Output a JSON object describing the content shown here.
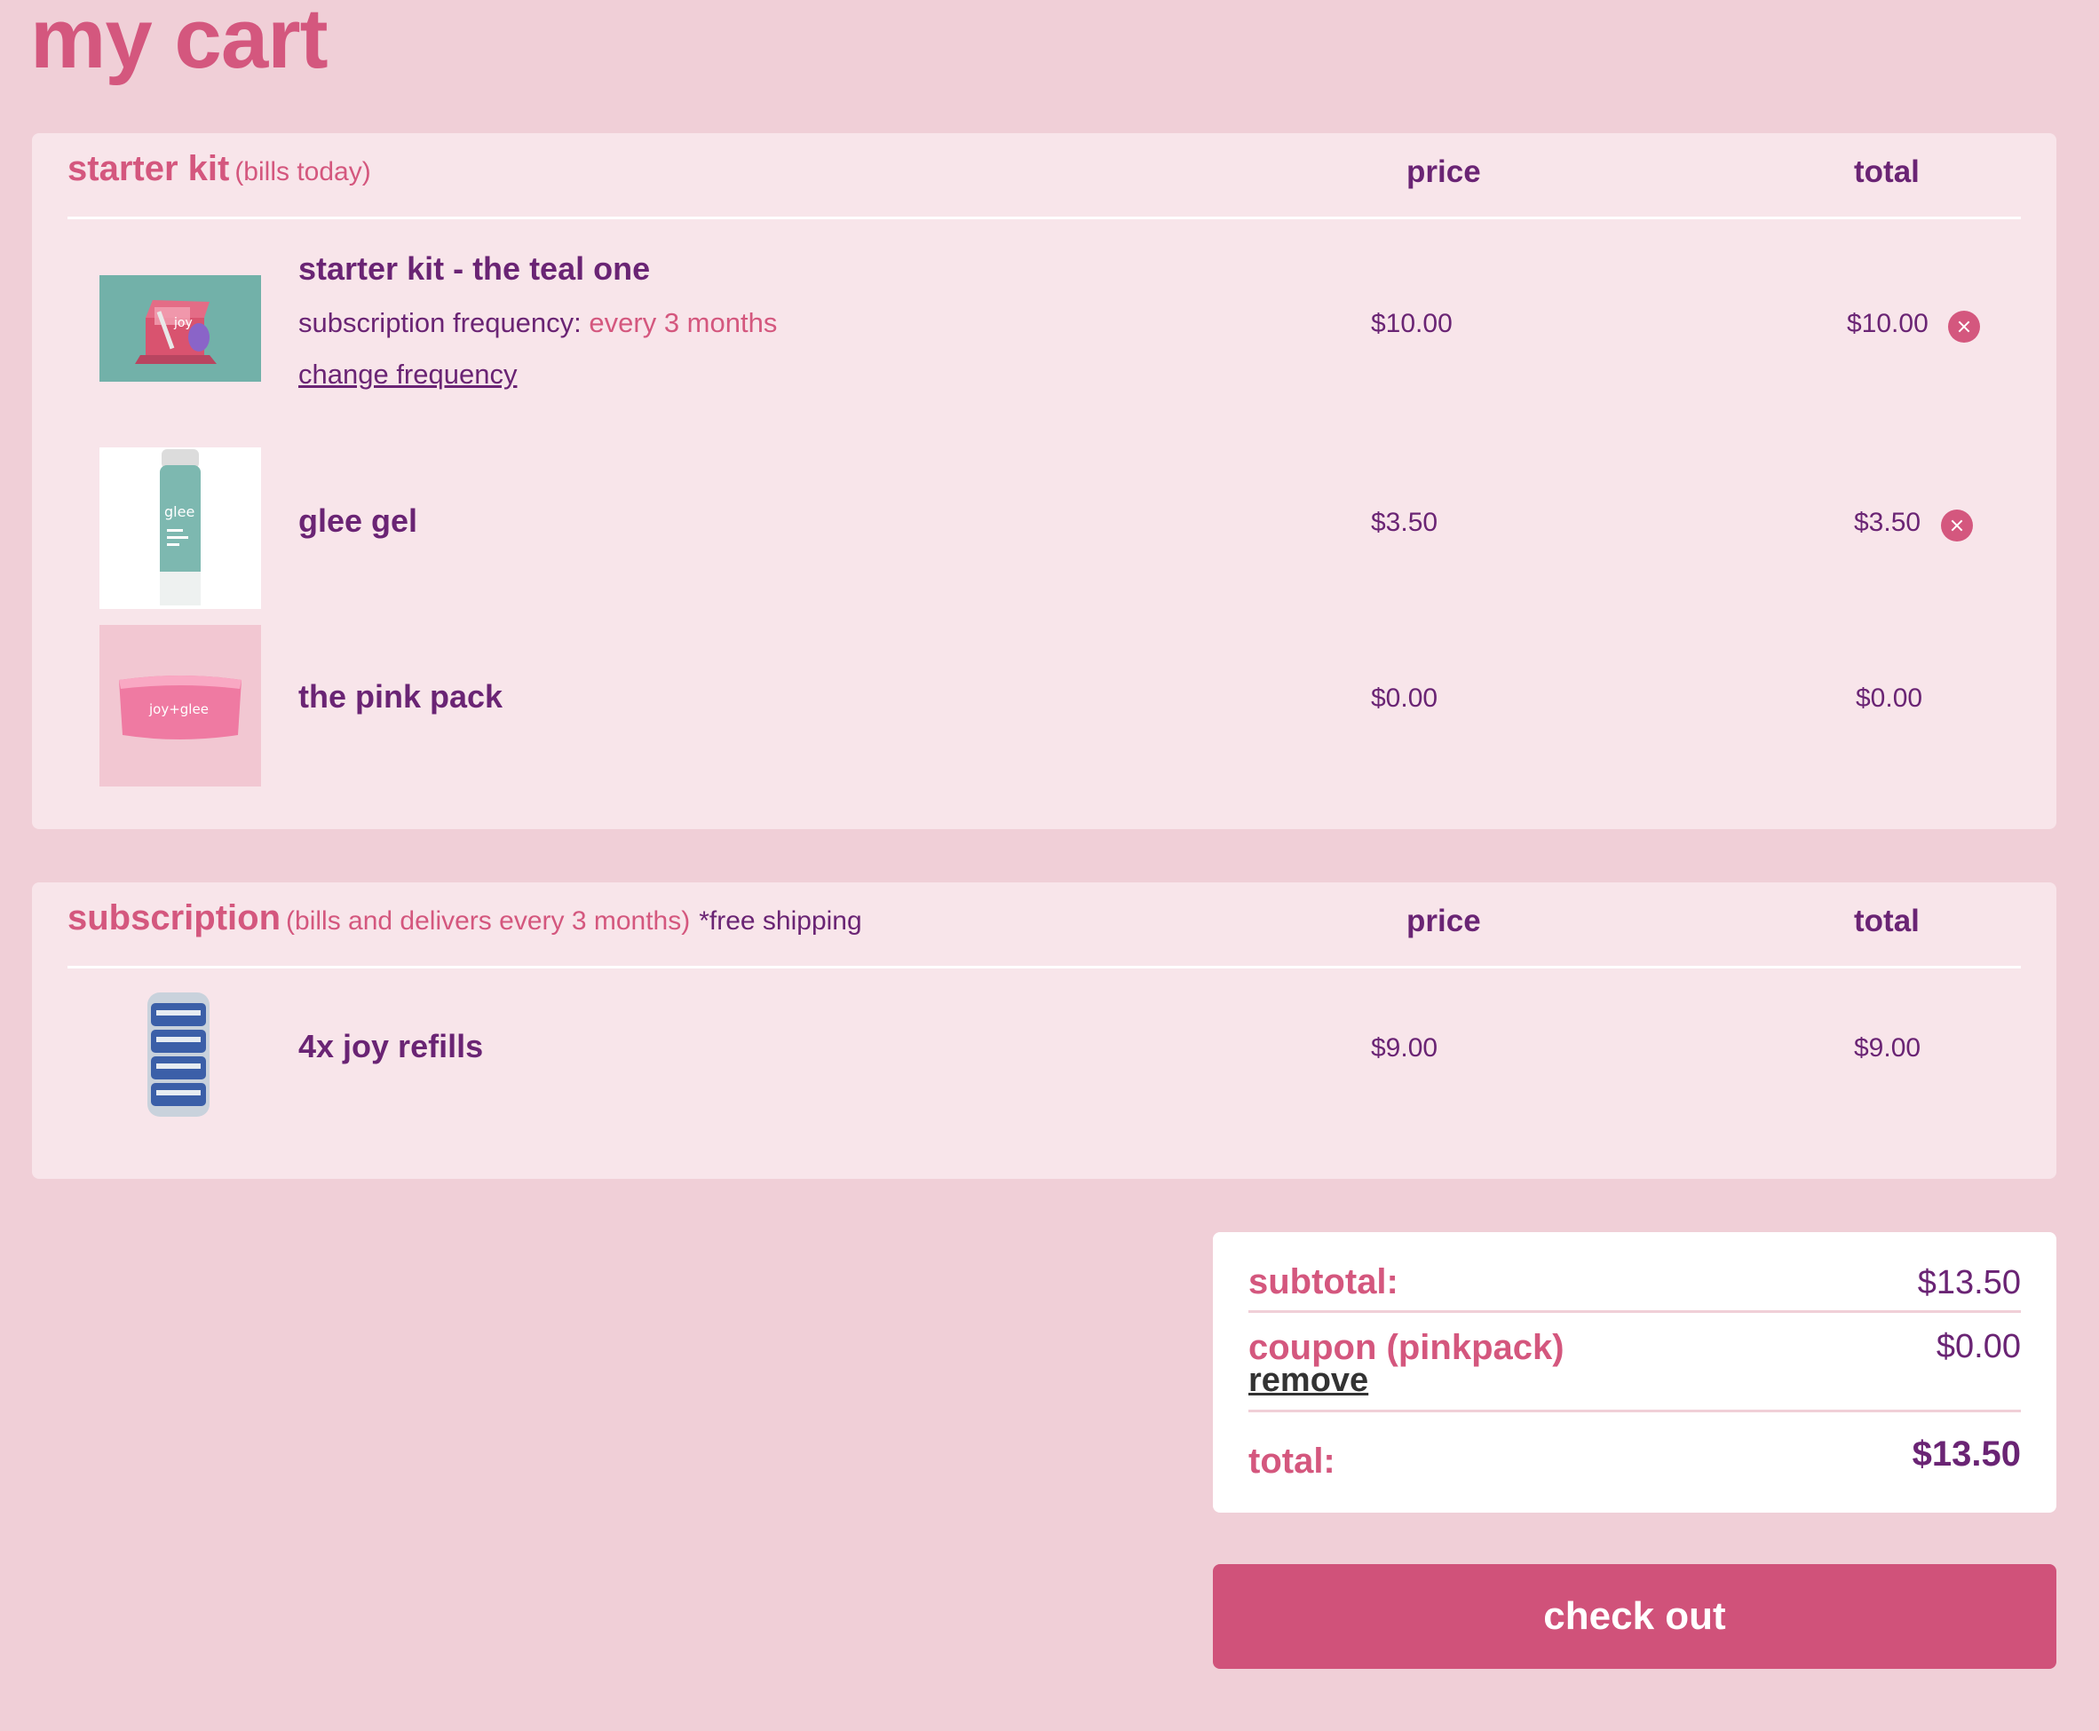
{
  "page": {
    "title": "my cart"
  },
  "starter_kit": {
    "title": "starter kit",
    "note": "(bills today)",
    "col_price": "price",
    "col_total": "total",
    "items": [
      {
        "name": "starter kit - the teal one",
        "frequency_label": "subscription frequency:",
        "frequency_value": "every 3 months",
        "change_link": "change frequency",
        "price": "$10.00",
        "total": "$10.00",
        "image_text": "joy",
        "removable": true
      },
      {
        "name": "glee gel",
        "price": "$3.50",
        "total": "$3.50",
        "image_text": "glee",
        "removable": true
      },
      {
        "name": "the pink pack",
        "price": "$0.00",
        "total": "$0.00",
        "image_text": "joy+glee",
        "removable": false
      }
    ]
  },
  "subscription": {
    "title": "subscription",
    "note": "(bills and delivers every 3 months)",
    "shipping_note": "*free shipping",
    "col_price": "price",
    "col_total": "total",
    "items": [
      {
        "name": "4x joy refills",
        "price": "$9.00",
        "total": "$9.00"
      }
    ]
  },
  "summary": {
    "subtotal_label": "subtotal:",
    "subtotal_value": "$13.50",
    "coupon_label": "coupon (pinkpack)",
    "coupon_value": "$0.00",
    "coupon_remove": "remove",
    "total_label": "total:",
    "total_value": "$13.50"
  },
  "actions": {
    "checkout_label": "check out"
  },
  "colors": {
    "background": "#f0cfd7",
    "panel": "#f8e5ea",
    "accent_pink": "#d4577e",
    "text_purple": "#6a2474",
    "button": "#d0527a"
  }
}
